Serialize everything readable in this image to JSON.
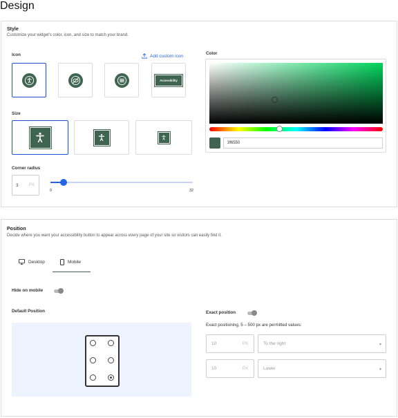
{
  "page_title": "Design",
  "style": {
    "title": "Style",
    "subtitle": "Customize your widget's color, icon, and size to match your brand.",
    "icon_label": "Icon",
    "add_custom_icon": "Add custom icon",
    "icon_options": [
      "accessibility-person-circle",
      "eye-slash-circle",
      "sliders-circle",
      "accessibility-badge"
    ],
    "badge_text": "Accessibility",
    "selected_icon_index": 0,
    "size_label": "Size",
    "size_options": [
      "large",
      "medium",
      "small"
    ],
    "selected_size_index": 0,
    "color_label": "Color",
    "hex_value": "3f6550",
    "brand_color": "#3f6550",
    "corner_radius_label": "Corner radius",
    "corner_radius_value": "3",
    "corner_radius_unit": "PX",
    "slider_min": "0",
    "slider_max": "32",
    "slider_value": 3
  },
  "position": {
    "title": "Position",
    "subtitle": "Decide where you want your accessibility button to appear across every page of your site so visitors can easily find it.",
    "tabs": [
      {
        "label": "Desktop",
        "icon": "monitor-icon",
        "active": false
      },
      {
        "label": "Mobile",
        "icon": "mobile-icon",
        "active": true
      }
    ],
    "hide_on_mobile_label": "Hide on mobile",
    "default_position_label": "Default Position",
    "selected_position": "bottom-right",
    "exact_position_label": "Exact position",
    "exact_help": "Exact positioning, 5 – 500 px are permitted values:",
    "row1": {
      "value": "10",
      "unit": "PX",
      "direction": "To the right"
    },
    "row2": {
      "value": "10",
      "unit": "PX",
      "direction": "Lower"
    }
  }
}
